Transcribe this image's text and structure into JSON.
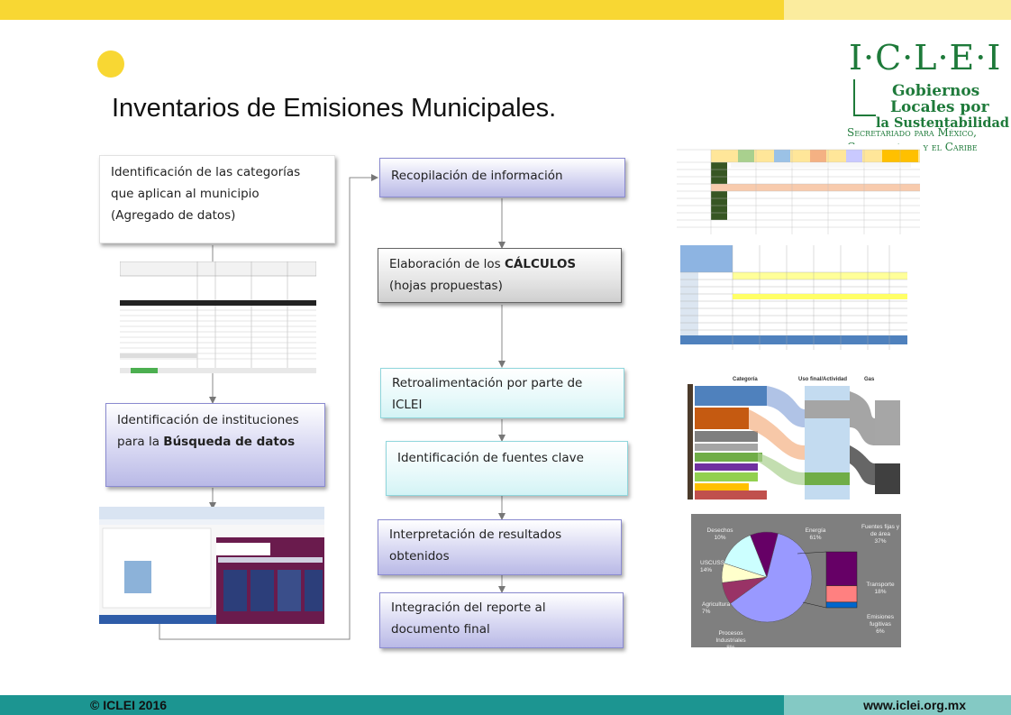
{
  "title": "Inventarios de Emisiones Municipales.",
  "footer": {
    "copyright": "© ICLEI 2016",
    "website": "www.iclei.org.mx"
  },
  "logo": {
    "name": "I·C·L·E·I",
    "line1": "Gobiernos",
    "line2": "Locales por",
    "line3": "la Sustentabilidad",
    "sub1": "Secretariado para México,",
    "sub2": "Centroamérica y el Caribe"
  },
  "steps": {
    "identificacion_categorias": {
      "line1": "Identificación  de las categorías",
      "line2": "que aplican al  municipio",
      "line3": "(Agregado de datos)"
    },
    "identificacion_instituciones": {
      "line1": "Identificación  de instituciones",
      "line2_pre": "para  la ",
      "line2_bold": "Búsqueda de datos"
    },
    "recopilacion": "Recopilación  de información",
    "calculos": {
      "pre": "Elaboración de los ",
      "bold": "CÁLCULOS",
      "line2": "(hojas propuestas)"
    },
    "retroalimentacion": {
      "line1": "Retroalimentación  por parte de",
      "line2": "ICLEI"
    },
    "fuentes_clave": "Identificación  de fuentes clave",
    "interpretacion": {
      "line1": "Interpretación  de resultados",
      "line2": "obtenidos"
    },
    "integracion": {
      "line1": "Integración  del reporte al",
      "line2": "documento final"
    }
  },
  "pie_chart": {
    "type": "pie",
    "slices": [
      {
        "label": "Energía",
        "value": 61,
        "display": "61%",
        "color": "#9999ff"
      },
      {
        "label": "Procesos Industriales",
        "value": 8,
        "display": "8%",
        "color": "#993366"
      },
      {
        "label": "Agricultura",
        "value": 7,
        "display": "7%",
        "color": "#ffffcc"
      },
      {
        "label": "USCUSS",
        "value": 14,
        "display": "14%",
        "color": "#ccffff"
      },
      {
        "label": "Desechos",
        "value": 10,
        "display": "10%",
        "color": "#660066"
      }
    ],
    "bar": [
      {
        "label": "Fuentes fijas y de área",
        "value": 37,
        "display": "37%",
        "color": "#660066"
      },
      {
        "label": "Transporte",
        "value": 18,
        "display": "18%",
        "color": "#ff8080"
      },
      {
        "label": "Emisiones fugitivas",
        "value": 6,
        "display": "6%",
        "color": "#0066cc"
      }
    ]
  },
  "sankey": {
    "headers": [
      "Categoría",
      "Uso final/Actividad",
      "Gas"
    ]
  }
}
